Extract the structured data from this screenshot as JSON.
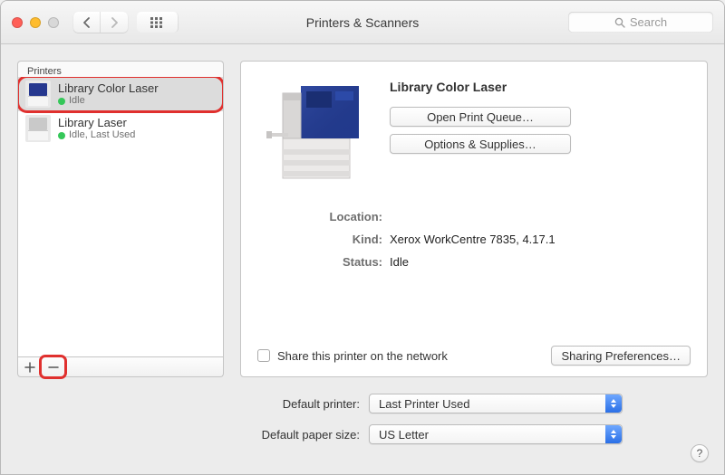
{
  "window_title": "Printers & Scanners",
  "search_placeholder": "Search",
  "sidebar": {
    "header": "Printers",
    "items": [
      {
        "name": "Library Color Laser",
        "status_text": "Idle",
        "selected": true,
        "thumb": "blue"
      },
      {
        "name": "Library Laser",
        "status_text": "Idle, Last Used",
        "selected": false,
        "thumb": "grey"
      }
    ]
  },
  "detail": {
    "title": "Library Color Laser",
    "open_queue_label": "Open Print Queue…",
    "options_supplies_label": "Options & Supplies…",
    "location_label": "Location:",
    "location_value": "",
    "kind_label": "Kind:",
    "kind_value": "Xerox WorkCentre 7835, 4.17.1",
    "status_label": "Status:",
    "status_value": "Idle",
    "share_label": "Share this printer on the network",
    "sharing_prefs_label": "Sharing Preferences…"
  },
  "defaults": {
    "printer_label": "Default printer:",
    "printer_value": "Last Printer Used",
    "paper_label": "Default paper size:",
    "paper_value": "US Letter"
  },
  "help_label": "?"
}
